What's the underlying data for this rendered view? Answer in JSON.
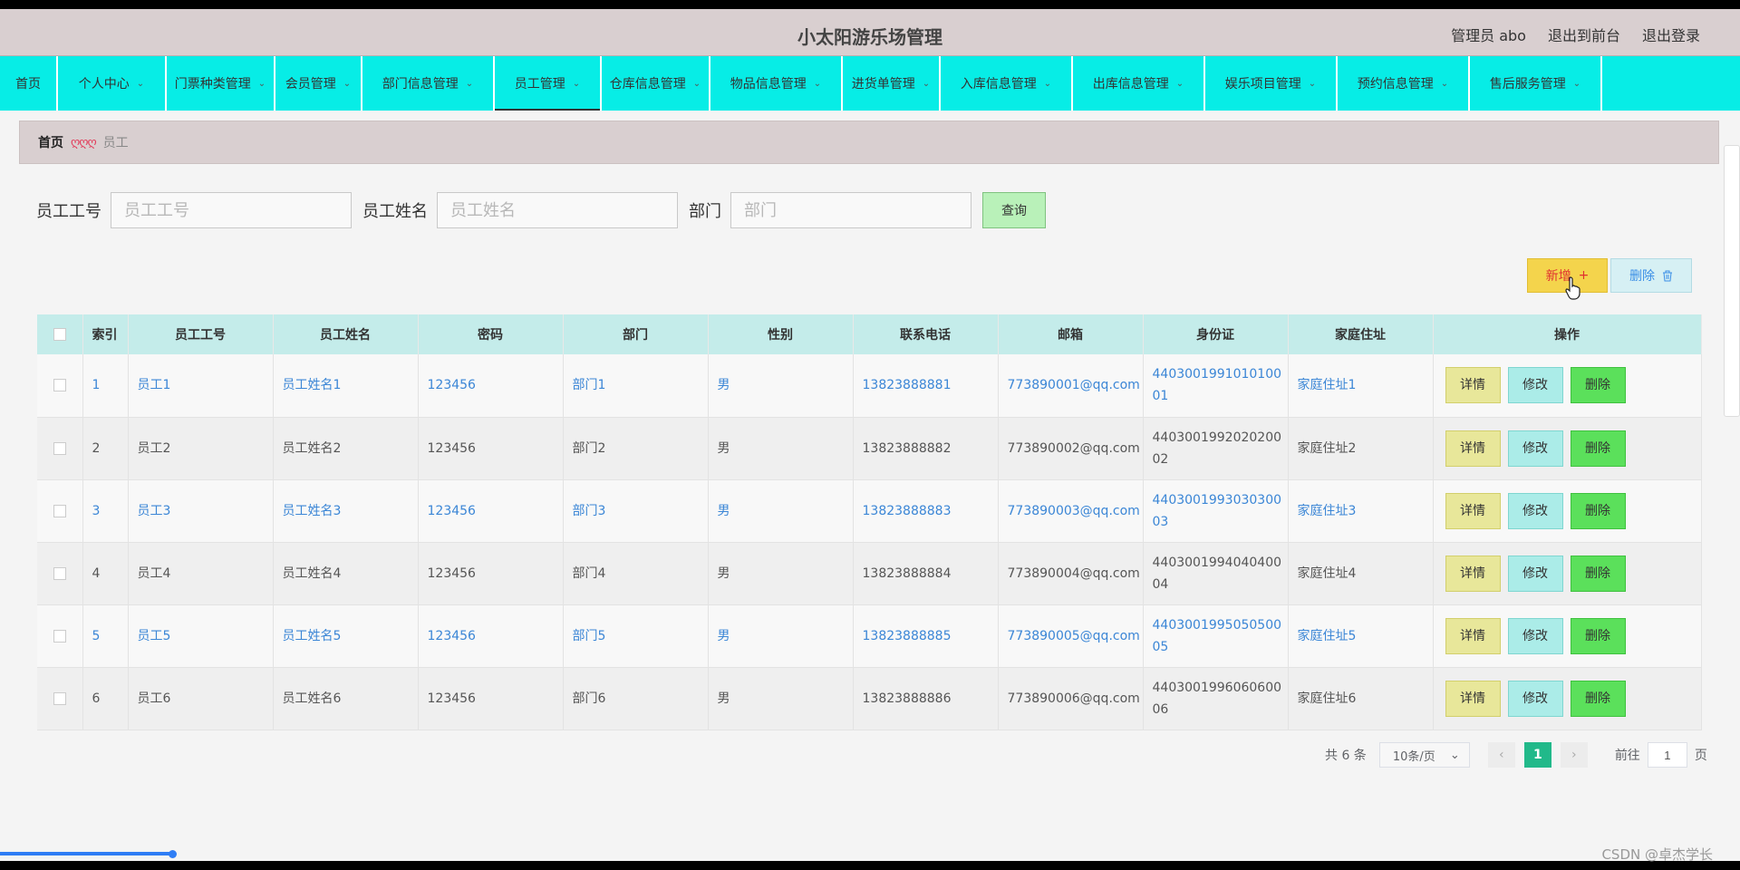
{
  "header": {
    "title": "小太阳游乐场管理",
    "user_label": "管理员 abo",
    "frontend_link": "退出到前台",
    "logout_link": "退出登录"
  },
  "nav": [
    {
      "label": "首页",
      "chevron": false,
      "active": false
    },
    {
      "label": "个人中心",
      "chevron": true,
      "active": false
    },
    {
      "label": "门票种类管理",
      "chevron": true,
      "active": false
    },
    {
      "label": "会员管理",
      "chevron": true,
      "active": false
    },
    {
      "label": "部门信息管理",
      "chevron": true,
      "active": false
    },
    {
      "label": "员工管理",
      "chevron": true,
      "active": true
    },
    {
      "label": "仓库信息管理",
      "chevron": true,
      "active": false
    },
    {
      "label": "物品信息管理",
      "chevron": true,
      "active": false
    },
    {
      "label": "进货单管理",
      "chevron": true,
      "active": false
    },
    {
      "label": "入库信息管理",
      "chevron": true,
      "active": false
    },
    {
      "label": "出库信息管理",
      "chevron": true,
      "active": false
    },
    {
      "label": "娱乐项目管理",
      "chevron": true,
      "active": false
    },
    {
      "label": "预约信息管理",
      "chevron": true,
      "active": false
    },
    {
      "label": "售后服务管理",
      "chevron": true,
      "active": false
    }
  ],
  "breadcrumb": {
    "home": "首页",
    "separator": "ღღღ",
    "current": "员工"
  },
  "search": {
    "emp_no_label": "员工工号",
    "emp_no_placeholder": "员工工号",
    "emp_name_label": "员工姓名",
    "emp_name_placeholder": "员工姓名",
    "dept_label": "部门",
    "dept_placeholder": "部门",
    "query_label": "查询"
  },
  "actions": {
    "add_label": "新增",
    "delete_label": "删除"
  },
  "table": {
    "columns": [
      "索引",
      "员工工号",
      "员工姓名",
      "密码",
      "部门",
      "性别",
      "联系电话",
      "邮箱",
      "身份证",
      "家庭住址",
      "操作"
    ],
    "rows": [
      {
        "index": "1",
        "no": "员工1",
        "name": "员工姓名1",
        "password": "123456",
        "dept": "部门1",
        "gender": "男",
        "phone": "13823888881",
        "email": "773890001@qq.com",
        "id_card": "440300199101010001",
        "address": "家庭住址1"
      },
      {
        "index": "2",
        "no": "员工2",
        "name": "员工姓名2",
        "password": "123456",
        "dept": "部门2",
        "gender": "男",
        "phone": "13823888882",
        "email": "773890002@qq.com",
        "id_card": "440300199202020002",
        "address": "家庭住址2"
      },
      {
        "index": "3",
        "no": "员工3",
        "name": "员工姓名3",
        "password": "123456",
        "dept": "部门3",
        "gender": "男",
        "phone": "13823888883",
        "email": "773890003@qq.com",
        "id_card": "440300199303030003",
        "address": "家庭住址3"
      },
      {
        "index": "4",
        "no": "员工4",
        "name": "员工姓名4",
        "password": "123456",
        "dept": "部门4",
        "gender": "男",
        "phone": "13823888884",
        "email": "773890004@qq.com",
        "id_card": "440300199404040004",
        "address": "家庭住址4"
      },
      {
        "index": "5",
        "no": "员工5",
        "name": "员工姓名5",
        "password": "123456",
        "dept": "部门5",
        "gender": "男",
        "phone": "13823888885",
        "email": "773890005@qq.com",
        "id_card": "440300199505050005",
        "address": "家庭住址5"
      },
      {
        "index": "6",
        "no": "员工6",
        "name": "员工姓名6",
        "password": "123456",
        "dept": "部门6",
        "gender": "男",
        "phone": "13823888886",
        "email": "773890006@qq.com",
        "id_card": "440300199606060006",
        "address": "家庭住址6"
      }
    ],
    "row_actions": {
      "detail": "详情",
      "edit": "修改",
      "delete": "删除"
    }
  },
  "pagination": {
    "total_text": "共 6 条",
    "page_size": "10条/页",
    "current_page": "1",
    "goto_label": "前往",
    "goto_value": "1",
    "page_suffix": "页"
  },
  "watermark": "CSDN @卓杰学长",
  "colors": {
    "nav_bg": "#07ede6",
    "header_bg": "#d9cfd0",
    "link": "#3b86d6",
    "page_active": "#21b98a"
  }
}
